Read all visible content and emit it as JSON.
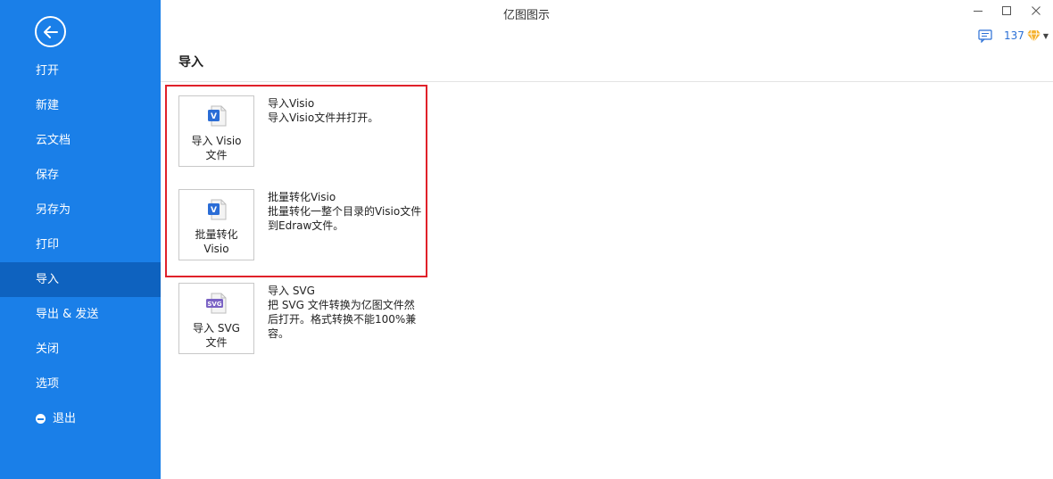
{
  "window": {
    "title": "亿图图示",
    "minimize": "—",
    "maximize": "☐",
    "close": "✕"
  },
  "user": {
    "count": "137"
  },
  "sidebar": {
    "items": [
      {
        "label": "打开"
      },
      {
        "label": "新建"
      },
      {
        "label": "云文档"
      },
      {
        "label": "保存"
      },
      {
        "label": "另存为"
      },
      {
        "label": "打印"
      },
      {
        "label": "导入",
        "active": true
      },
      {
        "label": "导出 & 发送"
      },
      {
        "label": "关闭"
      },
      {
        "label": "选项"
      },
      {
        "label": "退出"
      }
    ]
  },
  "main": {
    "title": "导入",
    "items": [
      {
        "tile_line1": "导入 Visio",
        "tile_line2": "文件",
        "title": "导入Visio",
        "description": "导入Visio文件并打开。",
        "icon_badge": "V"
      },
      {
        "tile_line1": "批量转化",
        "tile_line2": "Visio",
        "title": "批量转化Visio",
        "description": "批量转化一整个目录的Visio文件到Edraw文件。",
        "icon_badge": "V"
      },
      {
        "tile_line1": "导入 SVG",
        "tile_line2": "文件",
        "title": "导入 SVG",
        "description": "把 SVG 文件转换为亿图文件然后打开。格式转换不能100%兼容。",
        "icon_badge": "SVG"
      }
    ]
  },
  "colors": {
    "sidebar": "#1a7fe8",
    "sidebar_active": "#0e62bf",
    "highlight": "#e0212a",
    "visio_badge": "#2b6dd6",
    "svg_badge": "#7a62c4"
  }
}
